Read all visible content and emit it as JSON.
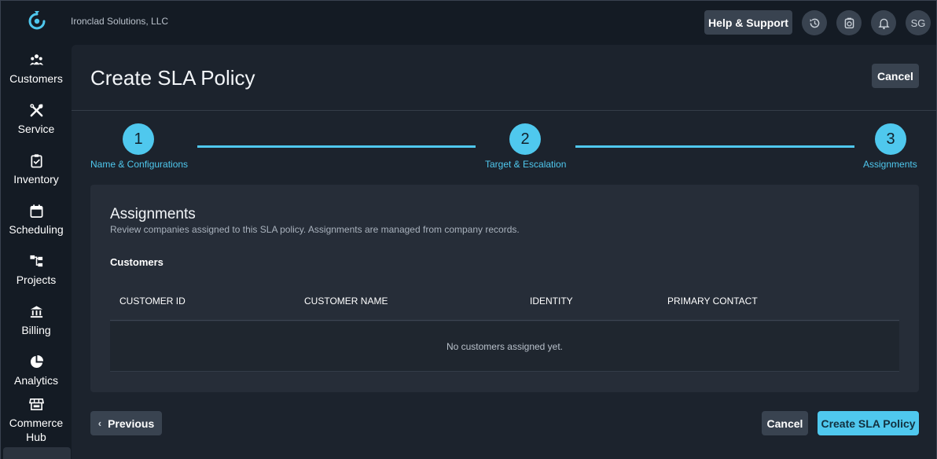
{
  "header": {
    "company": "Ironclad Solutions, LLC",
    "help_label": "Help & Support",
    "avatar_initials": "SG",
    "icons": [
      "history-icon",
      "timer-icon",
      "bell-icon"
    ]
  },
  "sidebar": {
    "items": [
      {
        "label": "Customers",
        "icon": "customers-icon"
      },
      {
        "label": "Service",
        "icon": "tools-icon"
      },
      {
        "label": "Inventory",
        "icon": "clipboard-check-icon"
      },
      {
        "label": "Scheduling",
        "icon": "calendar-icon"
      },
      {
        "label": "Projects",
        "icon": "hierarchy-icon"
      },
      {
        "label": "Billing",
        "icon": "bank-icon"
      },
      {
        "label": "Analytics",
        "icon": "pie-chart-icon"
      },
      {
        "label": "Commerce Hub",
        "icon": "store-icon"
      }
    ]
  },
  "page": {
    "title": "Create SLA Policy",
    "cancel_label": "Cancel"
  },
  "stepper": {
    "steps": [
      {
        "number": "1",
        "label": "Name & Configurations"
      },
      {
        "number": "2",
        "label": "Target & Escalation"
      },
      {
        "number": "3",
        "label": "Assignments"
      }
    ]
  },
  "assignments": {
    "title": "Assignments",
    "description": "Review companies assigned to this SLA policy. Assignments are managed from company records.",
    "section_label": "Customers",
    "columns": [
      "CUSTOMER ID",
      "CUSTOMER NAME",
      "IDENTITY",
      "PRIMARY CONTACT"
    ],
    "empty_text": "No customers assigned yet."
  },
  "footer": {
    "previous_label": "Previous",
    "cancel_label": "Cancel",
    "create_label": "Create SLA Policy"
  },
  "colors": {
    "accent": "#4fc8ee",
    "background": "#141b24",
    "panel": "#1c232d",
    "card": "#262d38"
  }
}
